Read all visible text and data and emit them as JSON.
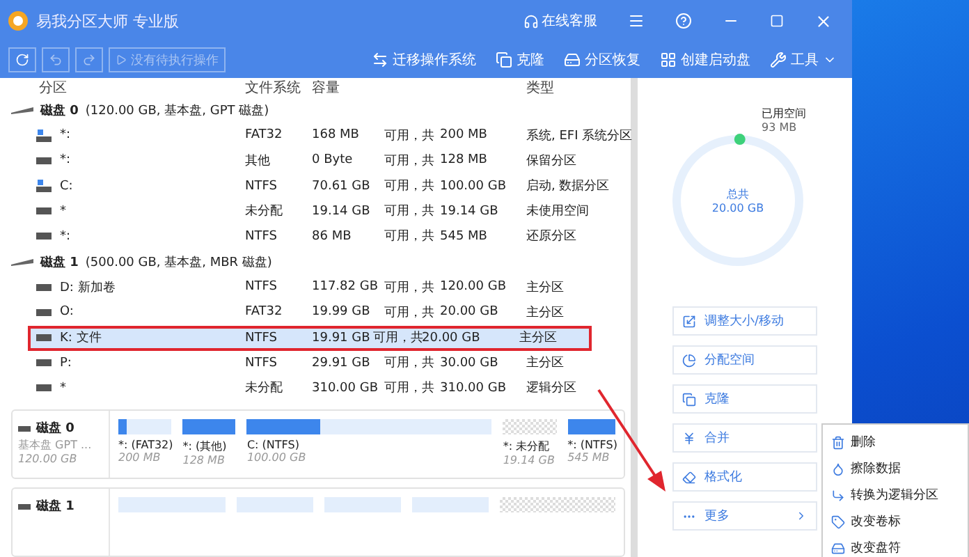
{
  "window": {
    "title": "易我分区大师 专业版",
    "support": "在线客服"
  },
  "toolbar": {
    "pending": "没有待执行操作",
    "actions": [
      {
        "kind": "migrate",
        "label": "迁移操作系统"
      },
      {
        "kind": "clone",
        "label": "克隆"
      },
      {
        "kind": "recover",
        "label": "分区恢复"
      },
      {
        "kind": "boot",
        "label": "创建启动盘"
      },
      {
        "kind": "tools",
        "label": "工具"
      }
    ]
  },
  "table": {
    "columns": [
      "分区",
      "文件系统",
      "容量",
      "类型"
    ],
    "disks": [
      {
        "name": "磁盘 0",
        "info": "(120.00 GB, 基本盘, GPT 磁盘)",
        "partitions": [
          {
            "kind": "system",
            "name": "*:",
            "fs": "FAT32",
            "free": "168 MB",
            "sep": "可用，共",
            "total": "200 MB",
            "type": "系统, EFI 系统分区",
            "selected": false
          },
          {
            "kind": "plain",
            "name": "*:",
            "fs": "其他",
            "free": "0 Byte",
            "sep": "可用，共",
            "total": "128 MB",
            "type": "保留分区",
            "selected": false
          },
          {
            "kind": "system",
            "name": "C:",
            "fs": "NTFS",
            "free": "70.61 GB",
            "sep": "可用，共",
            "total": "100.00 GB",
            "type": "启动, 数据分区",
            "selected": false
          },
          {
            "kind": "plain",
            "name": "*",
            "fs": "未分配",
            "free": "19.14 GB",
            "sep": "可用，共",
            "total": "19.14 GB",
            "type": "未使用空间",
            "selected": false
          },
          {
            "kind": "plain",
            "name": "*:",
            "fs": "NTFS",
            "free": "86 MB",
            "sep": "可用，共",
            "total": "545 MB",
            "type": "还原分区",
            "selected": false
          }
        ]
      },
      {
        "name": "磁盘 1",
        "info": "(500.00 GB, 基本盘, MBR 磁盘)",
        "partitions": [
          {
            "kind": "plain",
            "name": "D: 新加卷",
            "fs": "NTFS",
            "free": "117.82 GB",
            "sep": "可用，共",
            "total": "120.00 GB",
            "type": "主分区",
            "selected": false
          },
          {
            "kind": "plain",
            "name": "O:",
            "fs": "FAT32",
            "free": "19.99 GB",
            "sep": "可用，共",
            "total": "20.00 GB",
            "type": "主分区",
            "selected": false
          },
          {
            "kind": "plain",
            "name": "K: 文件",
            "fs": "NTFS",
            "free": "19.91 GB",
            "sep": "可用，共",
            "total": "20.00 GB",
            "type": "主分区",
            "selected": true
          },
          {
            "kind": "plain",
            "name": "P:",
            "fs": "NTFS",
            "free": "29.91 GB",
            "sep": "可用，共",
            "total": "30.00 GB",
            "type": "主分区",
            "selected": false
          },
          {
            "kind": "plain",
            "name": "*",
            "fs": "未分配",
            "free": "310.00 GB",
            "sep": "可用，共",
            "total": "310.00 GB",
            "type": "逻辑分区",
            "selected": false
          }
        ]
      }
    ]
  },
  "disk_map": [
    {
      "name": "磁盘 0",
      "kind_label": "基本盘 GPT ...",
      "size": "120.00 GB",
      "partitions": [
        {
          "kind": "used",
          "label": "*: (FAT32)",
          "size": "200 MB",
          "level": 0.15
        },
        {
          "kind": "used",
          "label": "*: (其他)",
          "size": "128 MB",
          "level": 1
        },
        {
          "kind": "used",
          "label": "C: (NTFS)",
          "size": "100.00 GB",
          "level": 0.3
        },
        {
          "kind": "unallocated",
          "label": "*: 未分配",
          "size": "19.14 GB"
        },
        {
          "kind": "used",
          "label": "*: (NTFS)",
          "size": "545 MB",
          "level": 1
        }
      ]
    },
    {
      "name": "磁盘 1",
      "partitions": [
        {
          "kind": "used"
        },
        {
          "kind": "used"
        },
        {
          "kind": "used"
        },
        {
          "kind": "used"
        },
        {
          "kind": "unallocated"
        }
      ]
    }
  ],
  "usage": {
    "used_label": "已用空间",
    "used": "93 MB",
    "total_label": "总共",
    "total": "20.00 GB",
    "level": 0.005
  },
  "actions": [
    {
      "kind": "resize",
      "label": "调整大小/移动"
    },
    {
      "kind": "allocate",
      "label": "分配空间"
    },
    {
      "kind": "clone",
      "label": "克隆"
    },
    {
      "kind": "merge",
      "label": "合并"
    },
    {
      "kind": "format",
      "label": "格式化"
    },
    {
      "kind": "more",
      "label": "更多"
    }
  ],
  "more_menu": [
    {
      "kind": "delete",
      "label": "删除"
    },
    {
      "kind": "wipe",
      "label": "擦除数据"
    },
    {
      "kind": "convert",
      "label": "转换为逻辑分区"
    },
    {
      "kind": "label",
      "label": "改变卷标"
    },
    {
      "kind": "letter",
      "label": "改变盘符"
    }
  ]
}
